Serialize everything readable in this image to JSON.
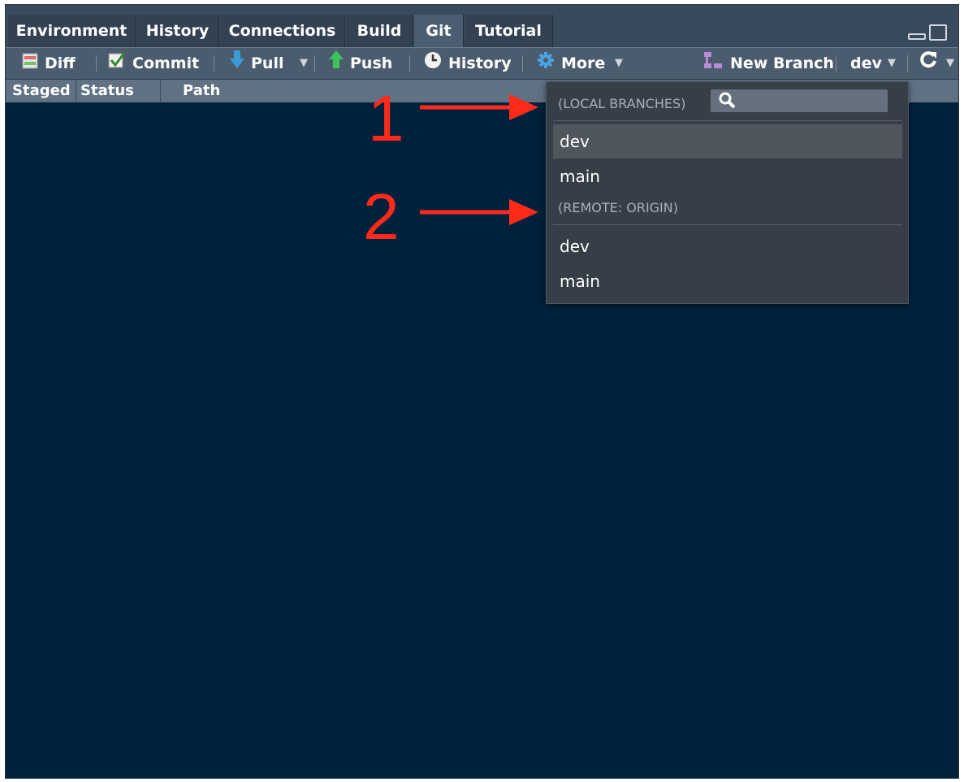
{
  "tabs": [
    {
      "label": "Environment"
    },
    {
      "label": "History"
    },
    {
      "label": "Connections"
    },
    {
      "label": "Build"
    },
    {
      "label": "Git",
      "active": true
    },
    {
      "label": "Tutorial"
    }
  ],
  "toolbar": {
    "diff_label": "Diff",
    "commit_label": "Commit",
    "pull_label": "Pull",
    "push_label": "Push",
    "history_label": "History",
    "more_label": "More",
    "new_branch_label": "New Branch",
    "branch_selector_label": "dev"
  },
  "columns": {
    "staged": "Staged",
    "status": "Status",
    "path": "Path"
  },
  "branch_menu": {
    "local_heading": "(LOCAL BRANCHES)",
    "search_placeholder": "",
    "local_branches": [
      {
        "name": "dev",
        "highlighted": true
      },
      {
        "name": "main"
      }
    ],
    "remote_heading": "(REMOTE: ORIGIN)",
    "remote_branches": [
      {
        "name": "dev"
      },
      {
        "name": "main"
      }
    ]
  },
  "annotations": [
    {
      "number": "1"
    },
    {
      "number": "2"
    }
  ],
  "colors": {
    "background": "#00213b",
    "annotation": "#ff2a1a",
    "pull_arrow": "#3a9bd8",
    "push_arrow": "#3cc35a",
    "more_gear": "#4aa3e0"
  }
}
